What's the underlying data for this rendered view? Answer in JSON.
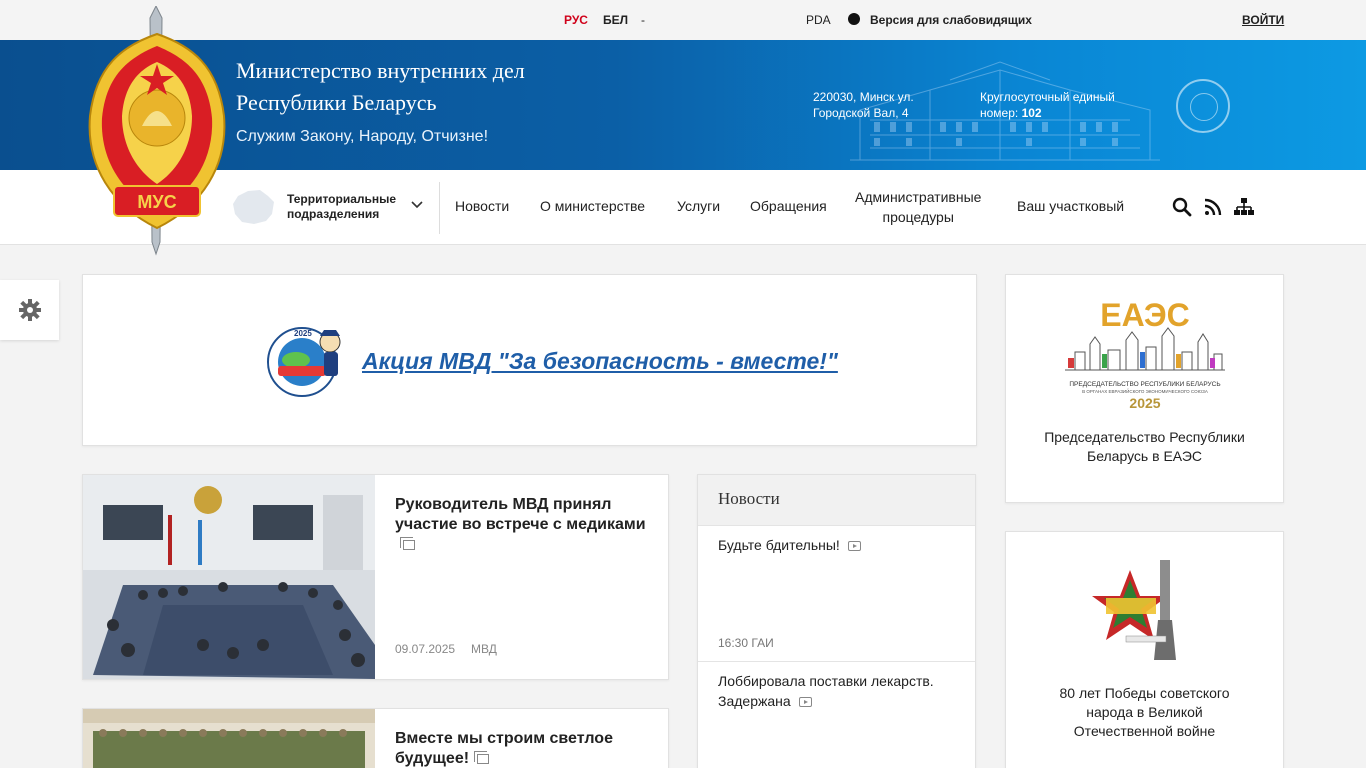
{
  "topbar": {
    "lang_ru": "РУС",
    "lang_be": "БЕЛ",
    "lang_dash": "-",
    "pda": "PDA",
    "low_vision": "Версия для слабовидящих",
    "login": "ВОЙТИ"
  },
  "header": {
    "title_line1": "Министерство внутренних дел",
    "title_line2": "Республики Беларусь",
    "slogan": "Служим Закону, Народу, Отчизне!",
    "address_line1": "220030, Минск ул.",
    "address_line2": "Городской Вал, 4",
    "hotline_line1": "Круглосуточный единый",
    "hotline_label": "номер:",
    "hotline_number": "102",
    "logo_text": "МУС"
  },
  "nav": {
    "territorial_line1": "Территориальные",
    "territorial_line2": "подразделения",
    "items": [
      "Новости",
      "О министерстве",
      "Услуги",
      "Обращения"
    ],
    "admin_line1": "Административные",
    "admin_line2": "процедуры",
    "district": "Ваш участковый"
  },
  "promo": {
    "link": "Акция МВД \"За безопасность - вместе!\"",
    "logo_year": "2025"
  },
  "news": [
    {
      "title": "Руководитель МВД принял участие во встрече с медиками",
      "date": "09.07.2025",
      "source": "МВД"
    },
    {
      "title": "Вместе мы строим светлое будущее!"
    }
  ],
  "feed": {
    "heading": "Новости",
    "items": [
      {
        "title": "Будьте бдительны!",
        "time": "16:30",
        "source": "ГАИ"
      },
      {
        "title": "Лоббировала поставки лекарств. Задержана"
      }
    ]
  },
  "sidebar": {
    "eaes_logo": "ЕАЭС",
    "eaes_sub1": "ПРЕДСЕДАТЕЛЬСТВО РЕСПУБЛИКИ БЕЛАРУСЬ",
    "eaes_sub2": "В ОРГАНАХ ЕВРАЗИЙСКОГО ЭКОНОМИЧЕСКОГО СОЮЗА",
    "eaes_year": "2025",
    "eaes_caption_line1": "Председательство Республики",
    "eaes_caption_line2": "Беларусь в ЕАЭС",
    "victory_caption_line1": "80 лет Победы советского",
    "victory_caption_line2": "народа в Великой",
    "victory_caption_line3": "Отечественной войне"
  },
  "colors": {
    "accent_blue": "#0b5fa6",
    "lang_active": "#d0021b",
    "link_blue": "#1f5ea8"
  }
}
